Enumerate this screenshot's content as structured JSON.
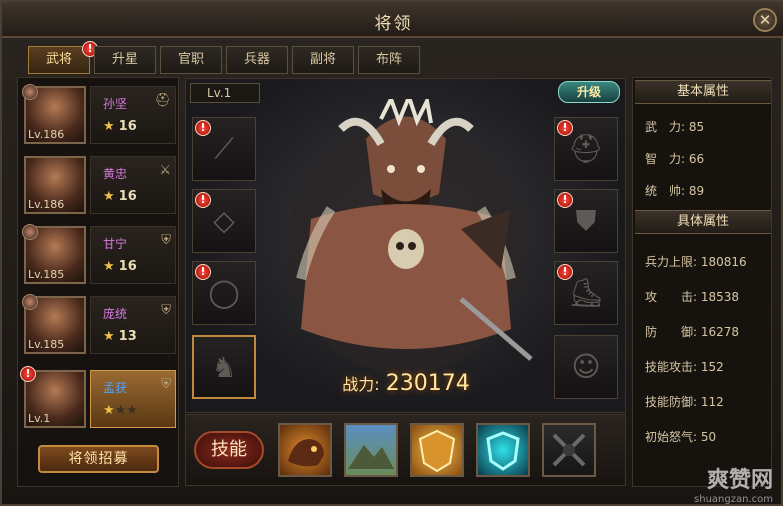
{
  "window": {
    "title": "将领",
    "close_label": "✕"
  },
  "tabs": [
    {
      "label": "武将",
      "active": true,
      "badge": "!"
    },
    {
      "label": "升星"
    },
    {
      "label": "官职"
    },
    {
      "label": "兵器"
    },
    {
      "label": "副将"
    },
    {
      "label": "布阵"
    }
  ],
  "heroes": [
    {
      "name": "孙坚",
      "level": "Lv.186",
      "stars": "16",
      "equip_icon": "helmet-icon"
    },
    {
      "name": "黄忠",
      "level": "Lv.186",
      "stars": "16",
      "equip_icon": "crossed-swords-icon"
    },
    {
      "name": "甘宁",
      "level": "Lv.185",
      "stars": "16",
      "equip_icon": "shield-icon"
    },
    {
      "name": "庞统",
      "level": "Lv.185",
      "stars": "13",
      "equip_icon": "shield-icon"
    },
    {
      "name": "孟获",
      "level": "Lv.1",
      "stars": "",
      "selected": true,
      "badge": "!",
      "equip_icon": "shield-icon"
    }
  ],
  "recruit_button": "将领招募",
  "center": {
    "level_label": "Lv.1",
    "upgrade_button": "升级",
    "power_label": "战力:",
    "power_value": "230174"
  },
  "slot_badge": "!",
  "skills": {
    "label": "技能"
  },
  "attributes": {
    "basic_header": "基本属性",
    "basic": [
      {
        "label": "武　力:",
        "value": "85"
      },
      {
        "label": "智　力:",
        "value": "66"
      },
      {
        "label": "统　帅:",
        "value": "89"
      }
    ],
    "detail_header": "具体属性",
    "detail": [
      {
        "label": "兵力上限:",
        "value": "180816"
      },
      {
        "label": "攻　　击:",
        "value": "18538"
      },
      {
        "label": "防　　御:",
        "value": "16278"
      },
      {
        "label": "技能攻击:",
        "value": "152"
      },
      {
        "label": "技能防御:",
        "value": "112"
      },
      {
        "label": "初始怒气:",
        "value": "50"
      }
    ]
  },
  "watermark": {
    "brand": "爽赞网",
    "url": "shuangzan.com"
  },
  "colors": {
    "accent": "#c08a3e",
    "badge_red": "#d1281a",
    "purple_name": "#d77ae0",
    "blue_name": "#4ea3ff"
  }
}
